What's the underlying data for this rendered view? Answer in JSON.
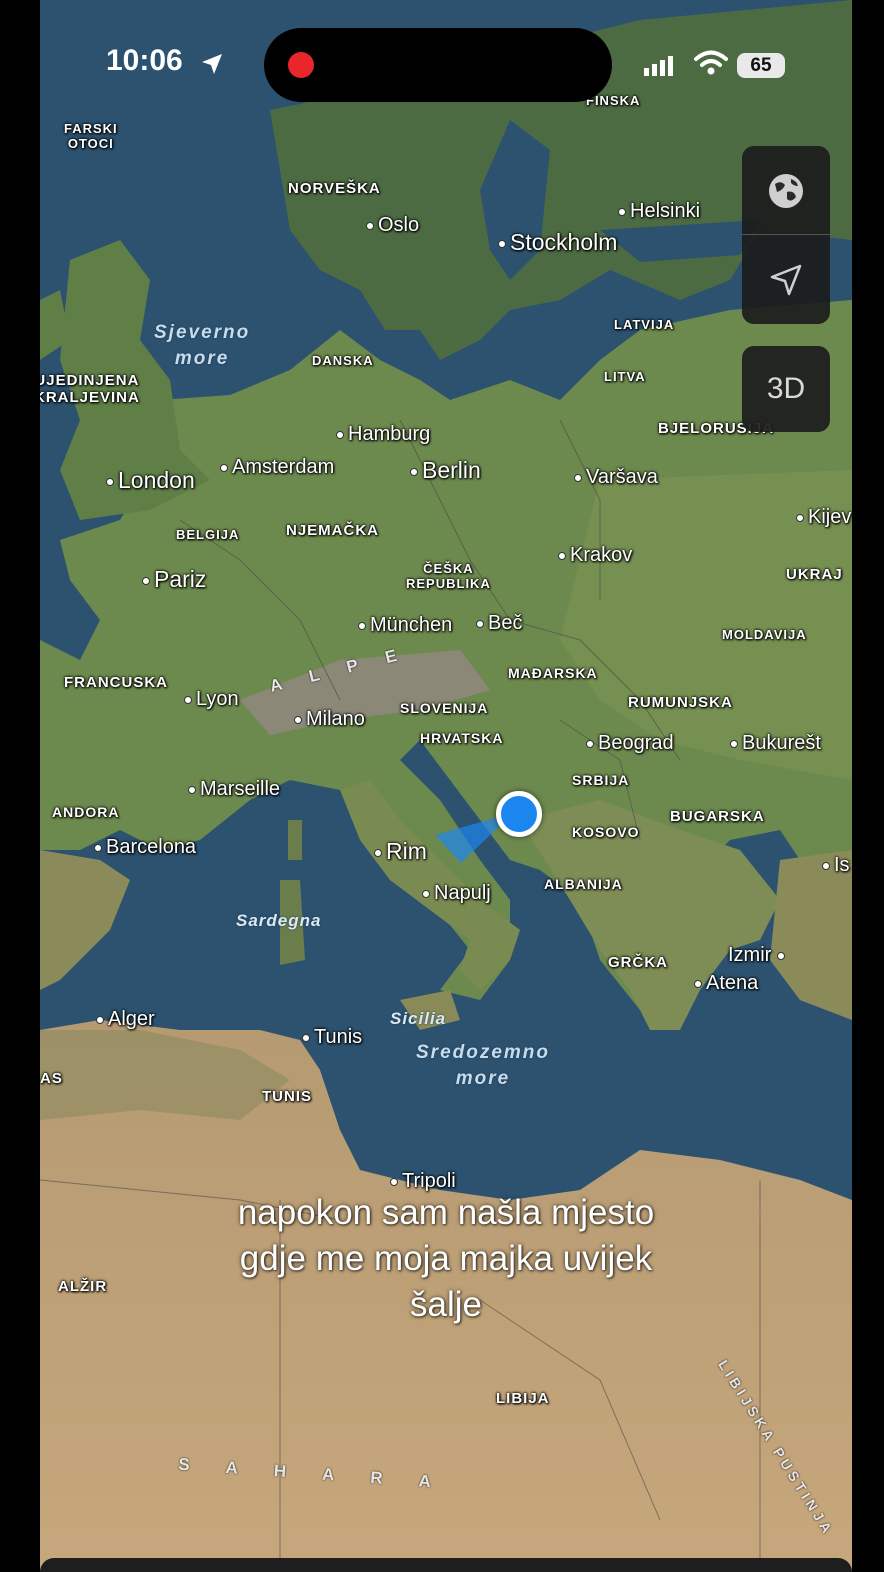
{
  "status_bar": {
    "time": "10:06",
    "battery": "65"
  },
  "controls": {
    "globe_icon": "globe-icon",
    "location_icon": "location-arrow-icon",
    "three_d_label": "3D"
  },
  "map": {
    "countries": {
      "farski": "FARSKI\nOTOCI",
      "norveska": "NORVEŠKA",
      "finska": "FINSKA",
      "danska": "DANSKA",
      "latvija": "LATVIJA",
      "litva": "LITVA",
      "uk": "UJEDINJENA\nKRALJEVINA",
      "bjelorusija": "BJELORUSIJA",
      "belgija": "BELGIJA",
      "njemacka": "NJEMAČKA",
      "ceska": "ČEŠKA\nREPUBLIKA",
      "ukrajina": "UKRAJ",
      "moldavija": "MOLDAVIJA",
      "francuska": "FRANCUSKA",
      "madjarska": "MAĐARSKA",
      "slovenija": "SLOVENIJA",
      "hrvatska": "HRVATSKA",
      "rumunjska": "RUMUNJSKA",
      "srbija": "SRBIJA",
      "andora": "ANDORA",
      "kosovo": "KOSOVO",
      "bugarska": "BUGARSKA",
      "albanija": "ALBANIJA",
      "grcka": "GRČKA",
      "tunis": "TUNIS",
      "alzir": "ALŽIR",
      "libija": "LIBIJA",
      "as": "AS"
    },
    "cities": {
      "oslo": "Oslo",
      "stockholm": "Stockholm",
      "helsinki": "Helsinki",
      "hamburg": "Hamburg",
      "amsterdam": "Amsterdam",
      "london": "London",
      "berlin": "Berlin",
      "varsava": "Varšava",
      "kijev": "Kijev",
      "krakov": "Krakov",
      "pariz": "Pariz",
      "munchen": "München",
      "bec": "Beč",
      "lyon": "Lyon",
      "milano": "Milano",
      "beograd": "Beograd",
      "bukurest": "Bukurešt",
      "marseille": "Marseille",
      "barcelona": "Barcelona",
      "rim": "Rim",
      "napulj": "Napulj",
      "istanbul": "Is",
      "izmir": "Izmir",
      "atena": "Atena",
      "alger": "Alger",
      "tunis": "Tunis",
      "tripoli": "Tripoli"
    },
    "seas": {
      "sjeverno": "Sjeverno\nmore",
      "sardegna": "Sardegna",
      "sicilia": "Sicilia",
      "sredozemno": "Sredozemno\nmore"
    },
    "regions": {
      "alpe": "A L P E",
      "sahara": "S A H A R A",
      "libijska": "LIBIJSKA PUSTINJA"
    }
  },
  "caption": "napokon sam našla mjesto\ngdje me moja majka uvijek\nšalje"
}
